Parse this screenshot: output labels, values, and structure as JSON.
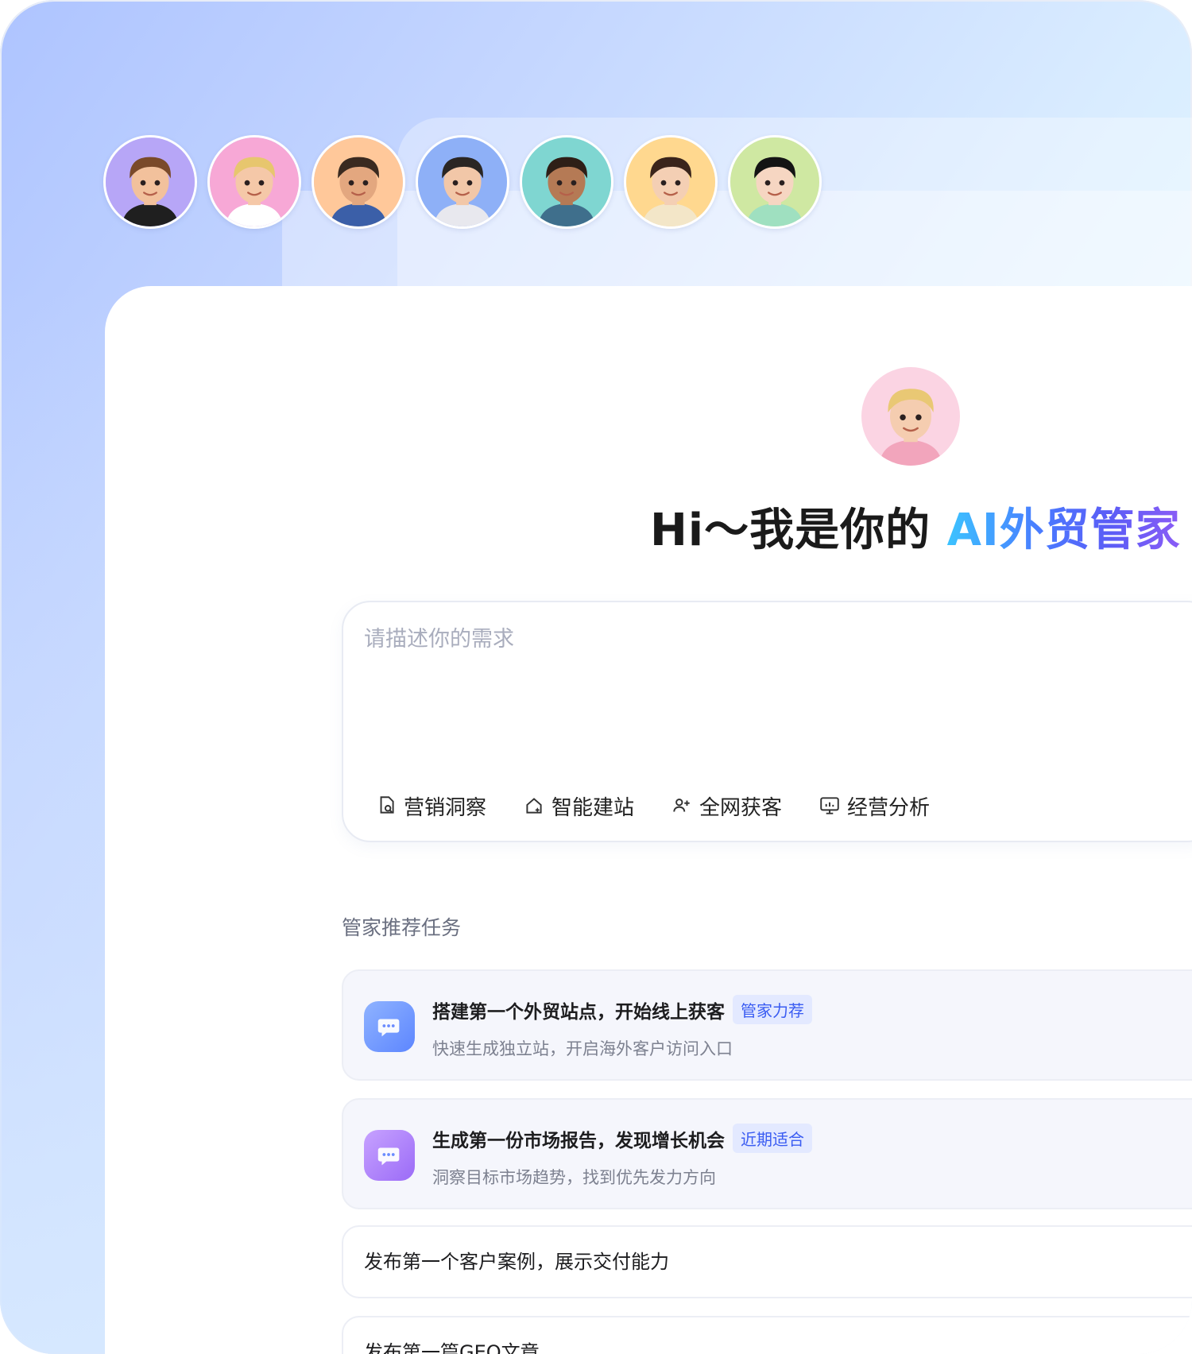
{
  "avatars": [
    {
      "name": "avatar-1",
      "bg": "#b7a6f7",
      "skin": "#f2c19c",
      "hair": "#7a4a2a",
      "shirt": "#1f1f1f"
    },
    {
      "name": "avatar-2",
      "bg": "#f7a8d6",
      "skin": "#f5c8a8",
      "hair": "#e7c66e",
      "shirt": "#ffffff"
    },
    {
      "name": "avatar-3",
      "bg": "#ffc89a",
      "skin": "#e3a77f",
      "hair": "#3a2a20",
      "shirt": "#3b5fa8"
    },
    {
      "name": "avatar-4",
      "bg": "#8eb0f7",
      "skin": "#f2c7a8",
      "hair": "#2a2624",
      "shirt": "#e8e8ee"
    },
    {
      "name": "avatar-5",
      "bg": "#7fd6d1",
      "skin": "#b57a55",
      "hair": "#2e1f17",
      "shirt": "#3f6f8c"
    },
    {
      "name": "avatar-6",
      "bg": "#ffd88f",
      "skin": "#f4cfb4",
      "hair": "#3a241b",
      "shirt": "#f3e6c8"
    },
    {
      "name": "avatar-7",
      "bg": "#cfe8a2",
      "skin": "#f6d6c2",
      "hair": "#141414",
      "shirt": "#9fe0c0"
    }
  ],
  "hero": {
    "bg": "#fbd4e3",
    "skin": "#f5cdb0",
    "hair": "#e9c874",
    "shirt": "#f2a5bc"
  },
  "headline": {
    "prefix": "Hi～我是你的 ",
    "accent": "AI外贸管家"
  },
  "input": {
    "placeholder": "请描述你的需求"
  },
  "modes": [
    {
      "label": "营销洞察",
      "icon": "document-search-icon"
    },
    {
      "label": "智能建站",
      "icon": "home-sparkle-icon"
    },
    {
      "label": "全网获客",
      "icon": "add-users-icon"
    },
    {
      "label": "经营分析",
      "icon": "monitor-chart-icon"
    }
  ],
  "section_title": "管家推荐任务",
  "tasks": [
    {
      "title": "搭建第一个外贸站点，开始线上获客",
      "badge": "管家力荐",
      "subtitle": "快速生成独立站，开启海外客户访问入口",
      "icon": "chat-bubble-icon",
      "color": "blue"
    },
    {
      "title": "生成第一份市场报告，发现增长机会",
      "badge": "近期适合",
      "subtitle": "洞察目标市场趋势，找到优先发力方向",
      "icon": "chat-bubble-icon",
      "color": "purple"
    }
  ],
  "plain_tasks": [
    {
      "title": "发布第一个客户案例，展示交付能力"
    },
    {
      "title": "发布第一篇GEO文章"
    }
  ]
}
